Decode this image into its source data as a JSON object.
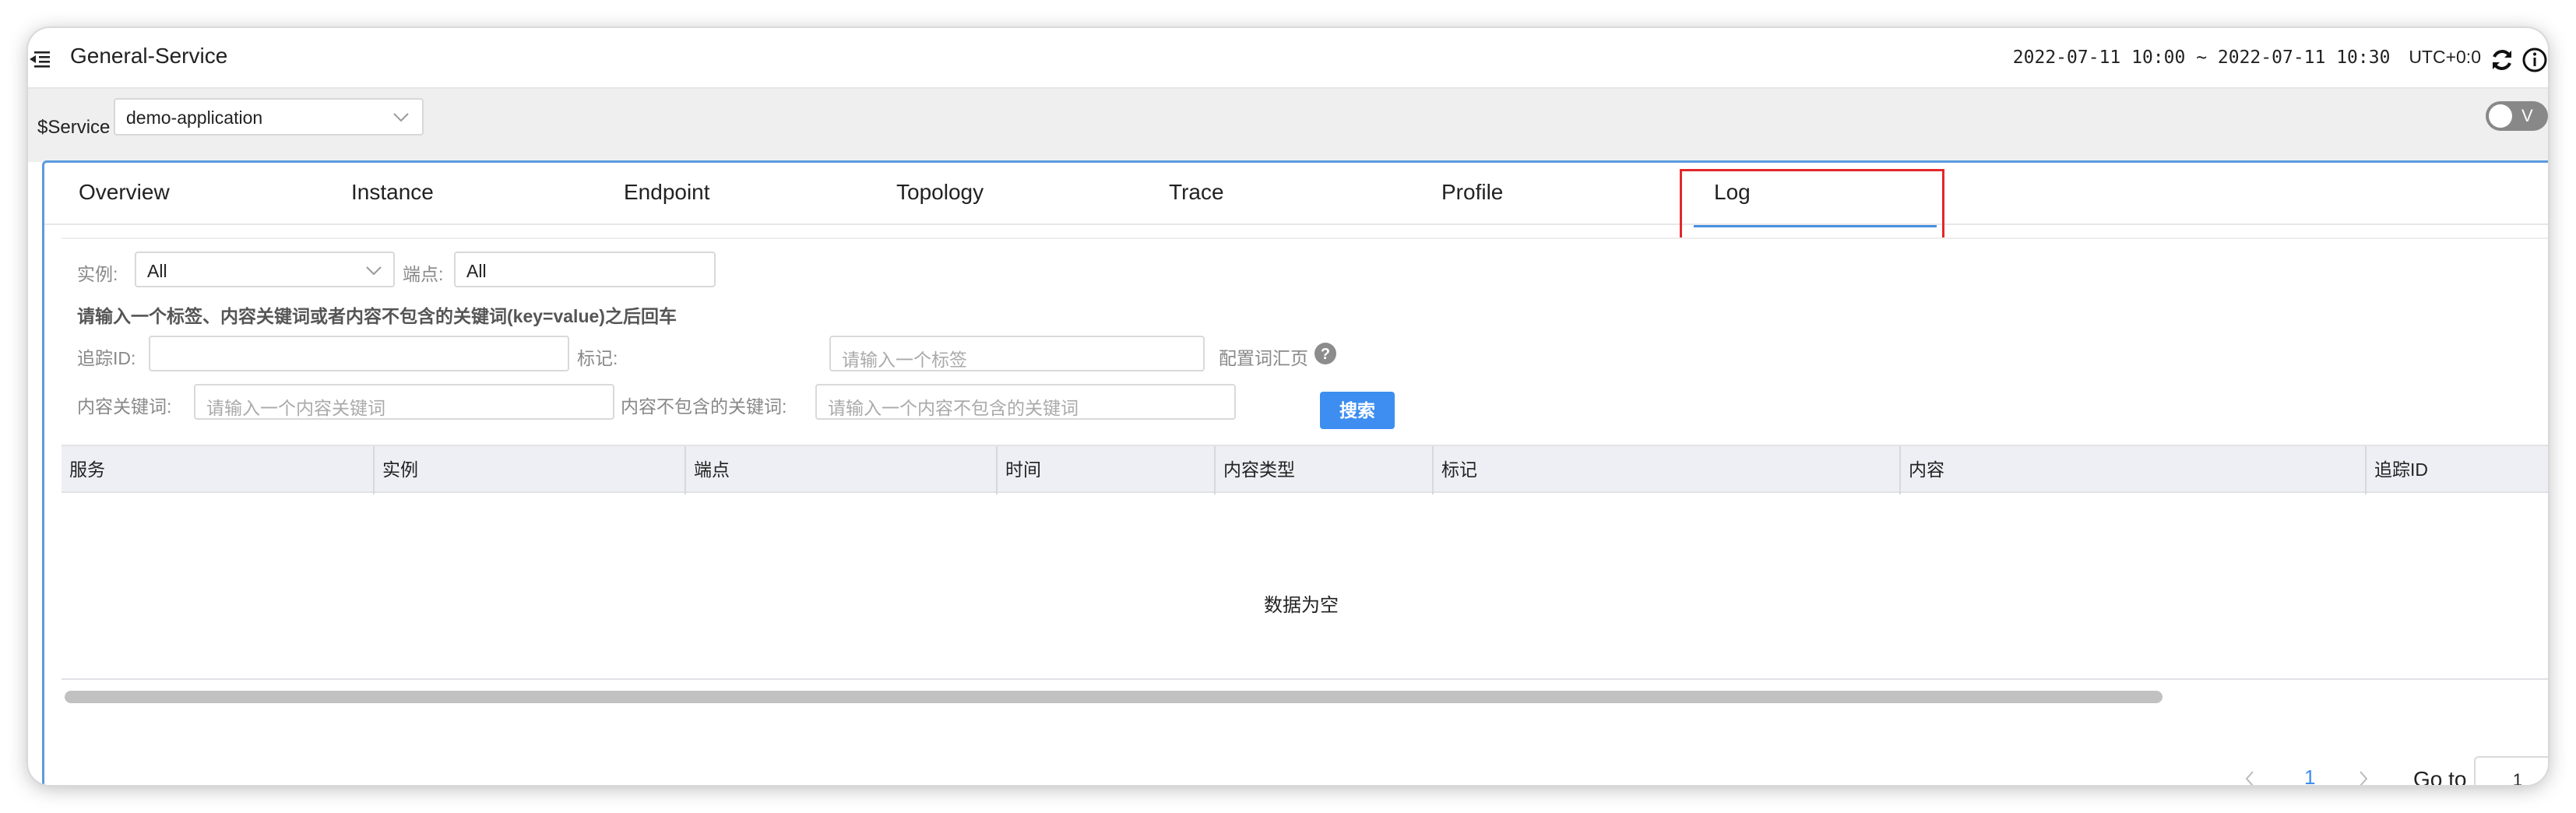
{
  "header": {
    "title": "General-Service",
    "time_range": "2022-07-11 10:00 ~ 2022-07-11 10:30",
    "timezone": "UTC+0:0"
  },
  "service_bar": {
    "label": "$Service",
    "selected": "demo-application",
    "toggle_label": "V"
  },
  "tabs": [
    {
      "label": "Overview"
    },
    {
      "label": "Instance"
    },
    {
      "label": "Endpoint"
    },
    {
      "label": "Topology"
    },
    {
      "label": "Trace"
    },
    {
      "label": "Profile"
    },
    {
      "label": "Log",
      "active": true
    }
  ],
  "filters": {
    "instance_label": "实例:",
    "instance_value": "All",
    "endpoint_label": "端点:",
    "endpoint_value": "All",
    "hint": "请输入一个标签、内容关键词或者内容不包含的关键词(key=value)之后回车",
    "trace_id_label": "追踪ID:",
    "trace_id_value": "",
    "tags_label": "标记:",
    "tags_placeholder": "请输入一个标签",
    "config_label": "配置词汇页",
    "keywords_label": "内容关键词:",
    "keywords_placeholder": "请输入一个内容关键词",
    "exclude_label": "内容不包含的关键词:",
    "exclude_placeholder": "请输入一个内容不包含的关键词",
    "search_button": "搜索"
  },
  "table": {
    "columns": [
      "服务",
      "实例",
      "端点",
      "时间",
      "内容类型",
      "标记",
      "内容",
      "追踪ID"
    ],
    "empty_text": "数据为空"
  },
  "pagination": {
    "current_page": "1",
    "goto_label": "Go to",
    "goto_value": "1"
  },
  "colors": {
    "accent": "#3d8ef0",
    "active_tab_highlight": "#e1282c",
    "panel_border": "#5b9bdf"
  }
}
